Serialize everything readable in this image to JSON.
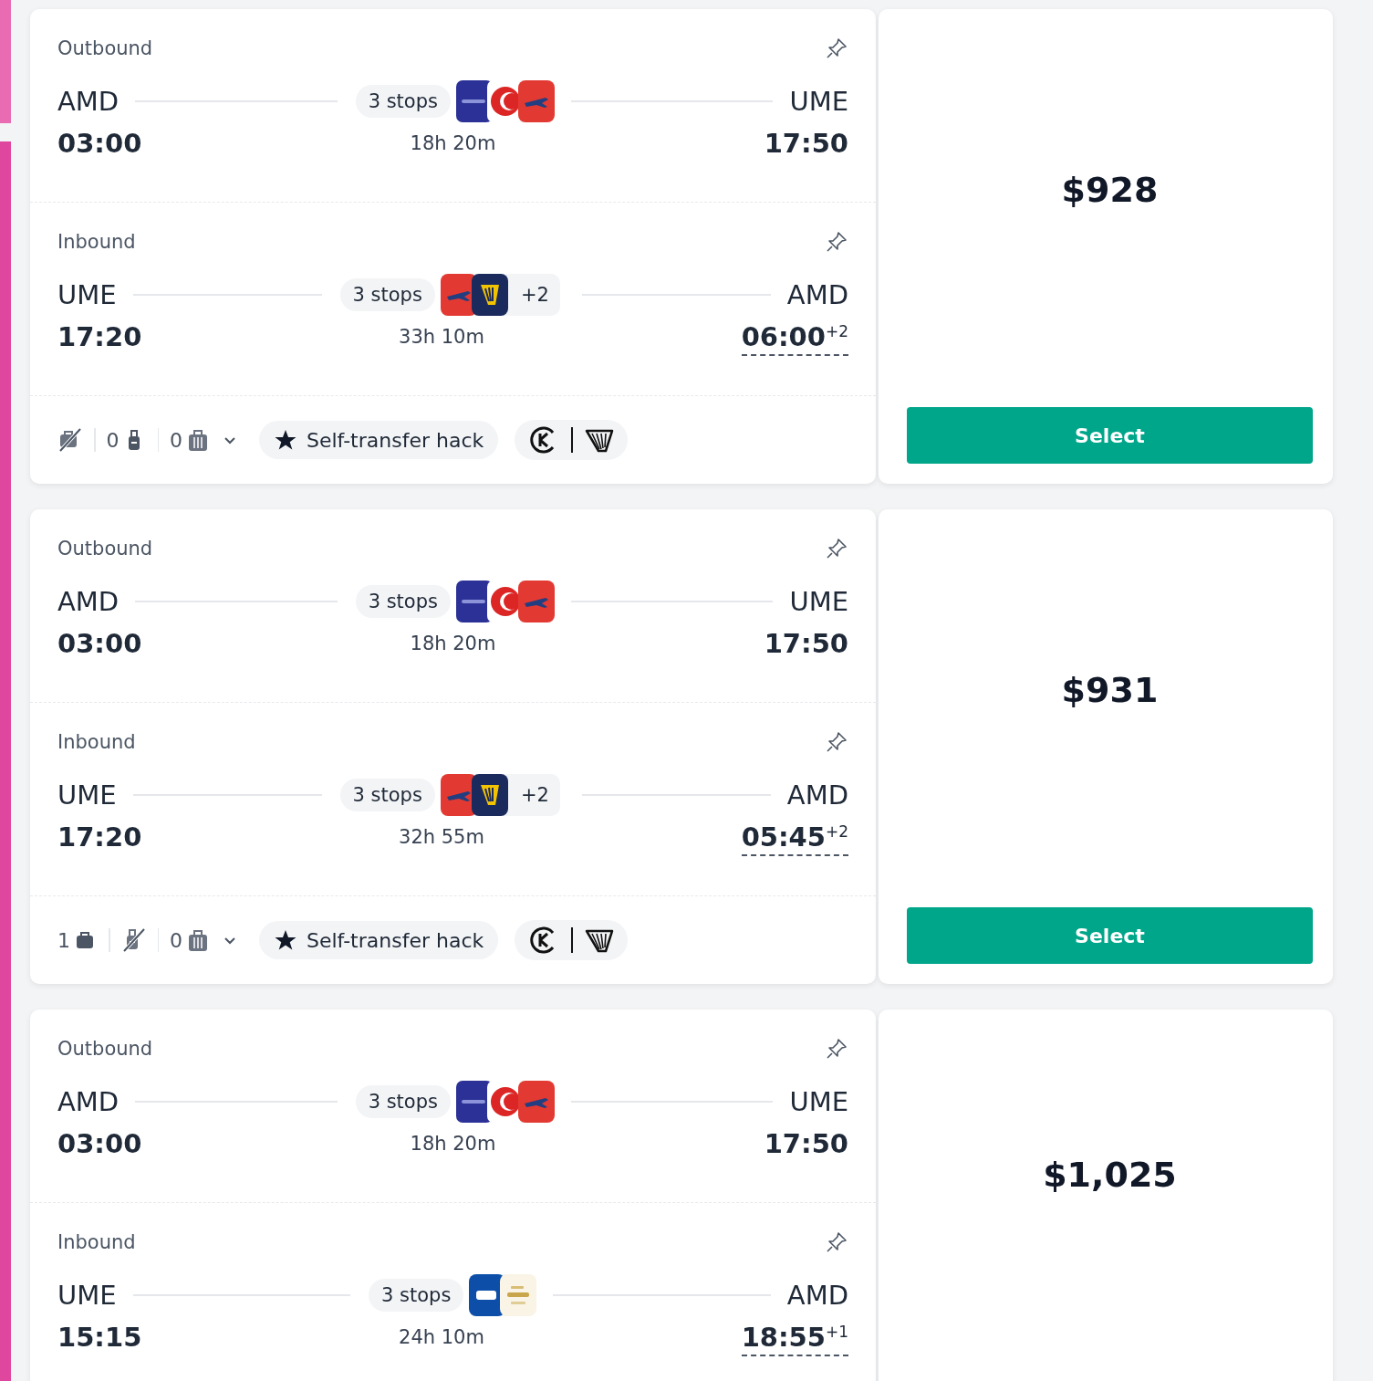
{
  "results": [
    {
      "legs": [
        {
          "label": "Outbound",
          "from": "AMD",
          "depart": "03:00",
          "stops": "3 stops",
          "duration": "18h 20m",
          "carriers": [
            {
              "kind": "indigo"
            },
            {
              "kind": "turkish"
            },
            {
              "kind": "red-plane"
            }
          ],
          "to": "UME",
          "arrive": "17:50"
        },
        {
          "label": "Inbound",
          "from": "UME",
          "depart": "17:20",
          "stops": "3 stops",
          "duration": "33h 10m",
          "carriers": [
            {
              "kind": "red-plane"
            },
            {
              "kind": "ryanair"
            }
          ],
          "more": "+2",
          "to": "AMD",
          "arrive": "06:00",
          "day_offset": "+2"
        }
      ],
      "bags": [
        {
          "kind": "personal",
          "included": false
        },
        {
          "kind": "cabin",
          "count": "0",
          "included": true
        },
        {
          "kind": "checked",
          "count": "0",
          "included": true
        }
      ],
      "badge": "Self-transfer hack",
      "price": "$928",
      "button": "Select"
    },
    {
      "legs": [
        {
          "label": "Outbound",
          "from": "AMD",
          "depart": "03:00",
          "stops": "3 stops",
          "duration": "18h 20m",
          "carriers": [
            {
              "kind": "indigo"
            },
            {
              "kind": "turkish"
            },
            {
              "kind": "red-plane"
            }
          ],
          "to": "UME",
          "arrive": "17:50"
        },
        {
          "label": "Inbound",
          "from": "UME",
          "depart": "17:20",
          "stops": "3 stops",
          "duration": "32h 55m",
          "carriers": [
            {
              "kind": "red-plane"
            },
            {
              "kind": "ryanair"
            }
          ],
          "more": "+2",
          "to": "AMD",
          "arrive": "05:45",
          "day_offset": "+2"
        }
      ],
      "bags": [
        {
          "kind": "personal",
          "count": "1",
          "included": true
        },
        {
          "kind": "cabin",
          "included": false
        },
        {
          "kind": "checked",
          "count": "0",
          "included": true
        }
      ],
      "badge": "Self-transfer hack",
      "price": "$931",
      "button": "Select"
    },
    {
      "legs": [
        {
          "label": "Outbound",
          "from": "AMD",
          "depart": "03:00",
          "stops": "3 stops",
          "duration": "18h 20m",
          "carriers": [
            {
              "kind": "indigo"
            },
            {
              "kind": "turkish"
            },
            {
              "kind": "red-plane"
            }
          ],
          "to": "UME",
          "arrive": "17:50"
        },
        {
          "label": "Inbound",
          "from": "UME",
          "depart": "15:15",
          "stops": "3 stops",
          "duration": "24h 10m",
          "carriers": [
            {
              "kind": "sas"
            },
            {
              "kind": "etihad"
            }
          ],
          "to": "AMD",
          "arrive": "18:55",
          "day_offset": "+1"
        }
      ],
      "price": "$1,025"
    }
  ]
}
